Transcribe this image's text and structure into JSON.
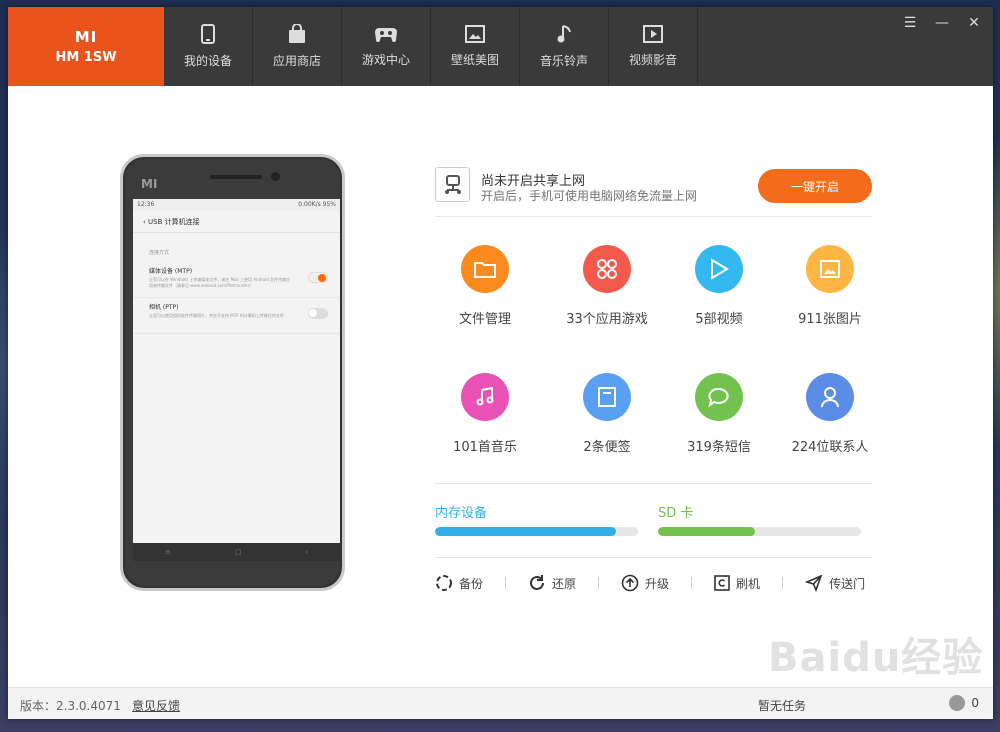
{
  "brand": {
    "logo": "MI",
    "model": "HM 1SW"
  },
  "nav": [
    {
      "label": "我的设备",
      "icon": "phone-icon"
    },
    {
      "label": "应用商店",
      "icon": "bag-icon"
    },
    {
      "label": "游戏中心",
      "icon": "gamepad-icon"
    },
    {
      "label": "壁纸美图",
      "icon": "picture-icon"
    },
    {
      "label": "音乐铃声",
      "icon": "music-note-icon"
    },
    {
      "label": "视频影音",
      "icon": "play-icon"
    }
  ],
  "window_controls": {
    "menu": "☰",
    "minimize": "—",
    "close": "✕"
  },
  "phone": {
    "logo": "MI",
    "status_time": "12:36",
    "status_speed": "0.00K/s",
    "status_battery": "95%",
    "screen_title": "USB 计算机连接",
    "section_label": "连接方式",
    "items": [
      {
        "title": "媒体设备 (MTP)",
        "desc": "让您可以在 Windows 上传输媒体文件，或在 Mac 上使用 Android 文件传输应用来传输文件（请参见 www.android.com/filetransfer）",
        "on": true
      },
      {
        "title": "相机 (PTP)",
        "desc": "让您可以使用相机软件传输照片，并在不支持 MTP 的计算机上传输任何文件",
        "on": false
      }
    ]
  },
  "share": {
    "title": "尚未开启共享上网",
    "subtitle": "开启后，手机可使用电脑网络免流量上网",
    "button": "一键开启"
  },
  "tiles": [
    {
      "label": "文件管理",
      "color": "#fb8a1e",
      "icon": "folder-icon"
    },
    {
      "label": "33个应用游戏",
      "color": "#f35a4c",
      "icon": "apps-icon"
    },
    {
      "label": "5部视频",
      "color": "#33b9f0",
      "icon": "video-play-icon"
    },
    {
      "label": "911张图片",
      "color": "#fdb544",
      "icon": "image-icon"
    },
    {
      "label": "101首音乐",
      "color": "#ea51b4",
      "icon": "music-icon"
    },
    {
      "label": "2条便签",
      "color": "#5aa0f2",
      "icon": "note-icon"
    },
    {
      "label": "319条短信",
      "color": "#73c24f",
      "icon": "message-icon"
    },
    {
      "label": "224位联系人",
      "color": "#5c8de6",
      "icon": "contact-icon"
    }
  ],
  "storage": [
    {
      "name": "内存设备",
      "color": "#33b0e8",
      "fill_percent": 89
    },
    {
      "name": "SD 卡",
      "color": "#74c04c",
      "fill_percent": 48
    }
  ],
  "actions": [
    {
      "label": "备份",
      "icon": "backup-icon"
    },
    {
      "label": "还原",
      "icon": "restore-icon"
    },
    {
      "label": "升级",
      "icon": "upgrade-icon"
    },
    {
      "label": "刷机",
      "icon": "flash-icon"
    },
    {
      "label": "传送门",
      "icon": "send-icon"
    }
  ],
  "footer": {
    "version": "版本：2.3.0.4071",
    "feedback": "意见反馈",
    "task": "暂无任务",
    "download_count": "0"
  },
  "watermark": "Baidu经验"
}
